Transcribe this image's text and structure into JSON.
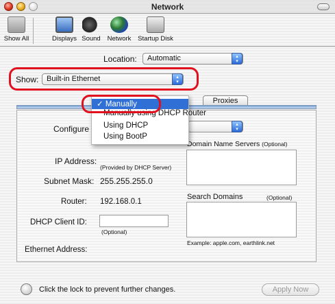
{
  "window": {
    "title": "Network"
  },
  "toolbar": {
    "items": [
      {
        "label": "Show All",
        "icon": "show-all-icon"
      },
      {
        "label": "Displays",
        "icon": "displays-icon"
      },
      {
        "label": "Sound",
        "icon": "sound-icon"
      },
      {
        "label": "Network",
        "icon": "network-icon"
      },
      {
        "label": "Startup Disk",
        "icon": "startup-disk-icon"
      }
    ]
  },
  "location": {
    "label": "Location:",
    "value": "Automatic"
  },
  "show": {
    "label": "Show:",
    "value": "Built-in Ethernet"
  },
  "tabs": {
    "proxies": "Proxies"
  },
  "configure": {
    "label": "Configure"
  },
  "menu": {
    "items": [
      "✓ Manually",
      "Manually using DHCP Router",
      "Using DHCP",
      "Using BootP"
    ]
  },
  "form": {
    "dns_label": "Domain Name Servers",
    "dns_opt": "(Optional)",
    "ip_label": "IP Address:",
    "ip_note": "(Provided by DHCP Server)",
    "subnet_label": "Subnet Mask:",
    "subnet_value": "255.255.255.0",
    "router_label": "Router:",
    "router_value": "192.168.0.1",
    "search_label": "Search Domains",
    "search_opt": "(Optional)",
    "dhcp_label": "DHCP Client ID:",
    "dhcp_opt": "(Optional)",
    "example": "Example: apple.com, earthlink.net",
    "ethernet_label": "Ethernet Address:"
  },
  "footer": {
    "lock_text": "Click the lock to prevent further changes.",
    "apply": "Apply Now"
  },
  "colors": {
    "highlight": "#e0101e",
    "selection": "#2f6fd6"
  }
}
